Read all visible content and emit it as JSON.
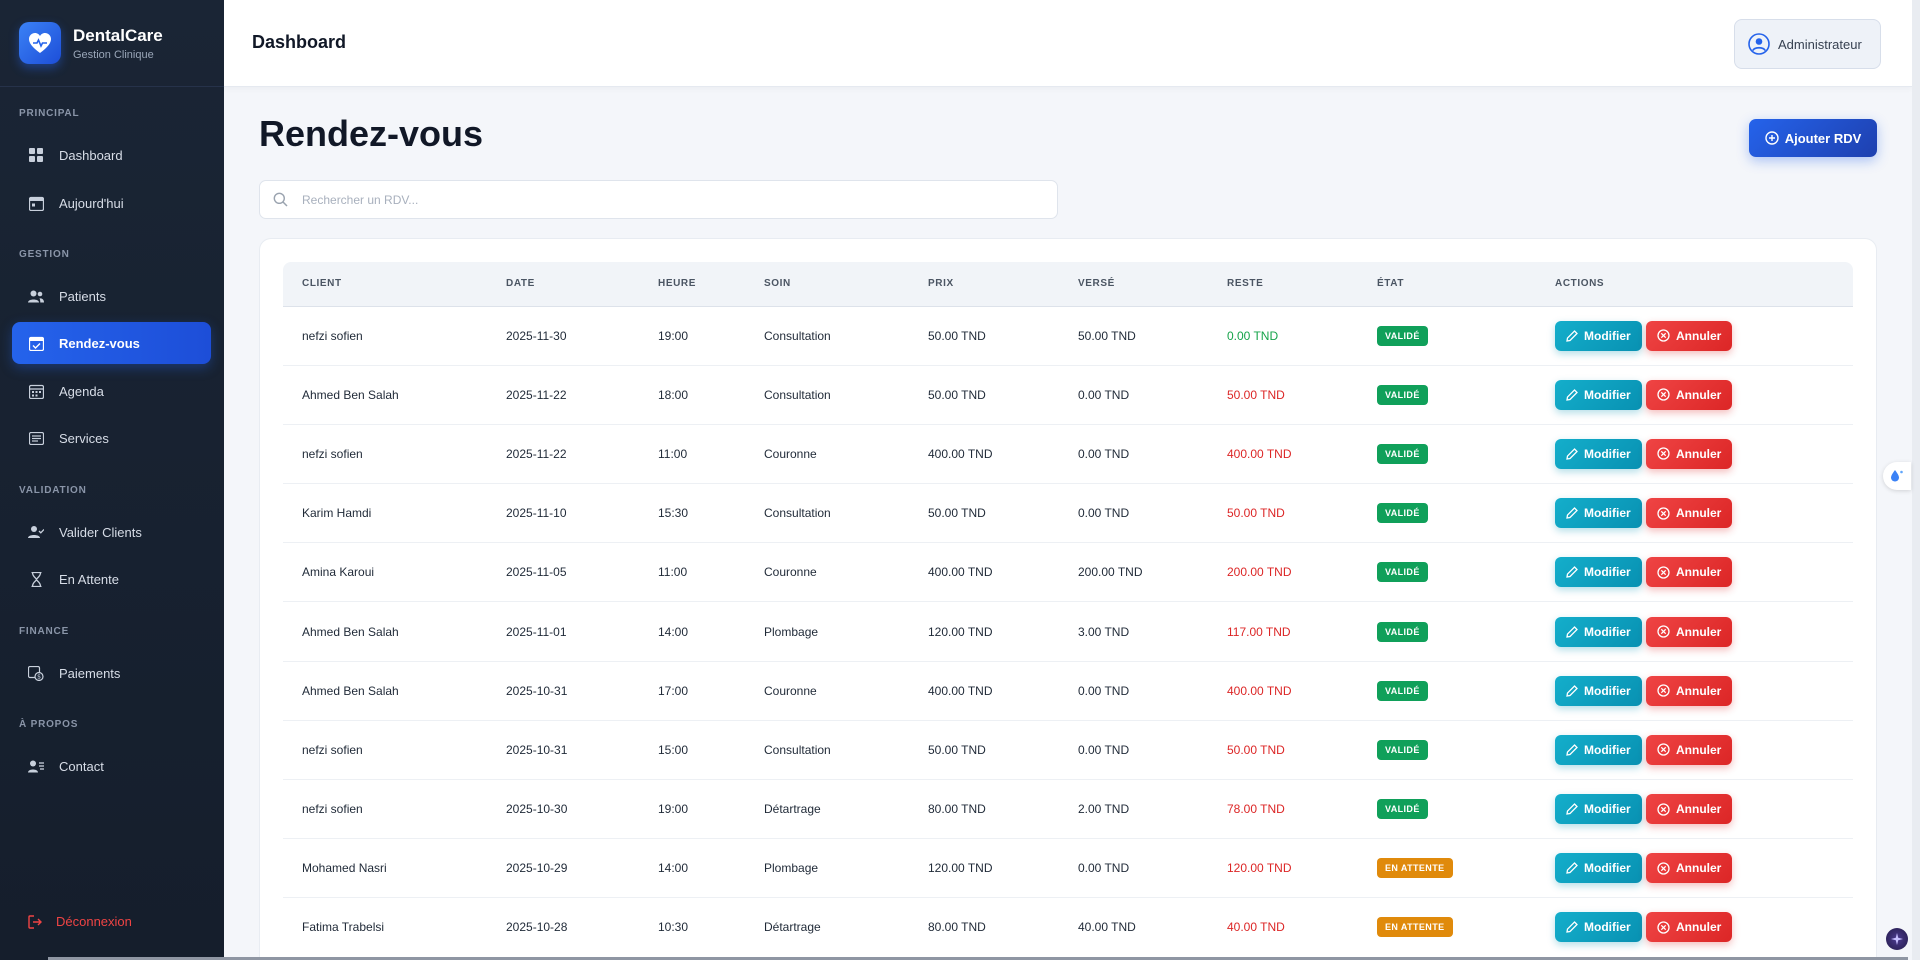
{
  "brand": {
    "name": "DentalCare",
    "subtitle": "Gestion Clinique"
  },
  "sidebar": {
    "sections": [
      {
        "label": "PRINCIPAL"
      },
      {
        "label": "GESTION"
      },
      {
        "label": "VALIDATION"
      },
      {
        "label": "FINANCE"
      },
      {
        "label": "À PROPOS"
      }
    ],
    "items": [
      {
        "label": "Dashboard",
        "icon": "grid-icon"
      },
      {
        "label": "Aujourd'hui",
        "icon": "calendar-day-icon"
      },
      {
        "label": "Patients",
        "icon": "users-icon"
      },
      {
        "label": "Rendez-vous",
        "icon": "calendar-check-icon",
        "active": true
      },
      {
        "label": "Agenda",
        "icon": "calendar-icon"
      },
      {
        "label": "Services",
        "icon": "list-icon"
      },
      {
        "label": "Valider Clients",
        "icon": "user-check-icon"
      },
      {
        "label": "En Attente",
        "icon": "hourglass-icon"
      },
      {
        "label": "Paiements",
        "icon": "payment-icon"
      },
      {
        "label": "Contact",
        "icon": "contact-icon"
      }
    ],
    "logout": "Déconnexion"
  },
  "header": {
    "title": "Dashboard",
    "user": "Administrateur"
  },
  "main": {
    "title": "Rendez-vous",
    "add_button": "Ajouter RDV",
    "search_placeholder": "Rechercher un RDV..."
  },
  "table": {
    "columns": [
      "CLIENT",
      "DATE",
      "HEURE",
      "SOIN",
      "PRIX",
      "VERSÉ",
      "RESTE",
      "ÉTAT",
      "ACTIONS"
    ],
    "edit_label": "Modifier",
    "cancel_label": "Annuler",
    "rows": [
      {
        "client": "nefzi sofien",
        "date": "2025-11-30",
        "heure": "19:00",
        "soin": "Consultation",
        "prix": "50.00 TND",
        "verse": "50.00 TND",
        "reste": "0.00 TND",
        "reste_status": "paid",
        "etat": "VALIDÉ",
        "etat_status": "valide"
      },
      {
        "client": "Ahmed Ben Salah",
        "date": "2025-11-22",
        "heure": "18:00",
        "soin": "Consultation",
        "prix": "50.00 TND",
        "verse": "0.00 TND",
        "reste": "50.00 TND",
        "reste_status": "due",
        "etat": "VALIDÉ",
        "etat_status": "valide"
      },
      {
        "client": "nefzi sofien",
        "date": "2025-11-22",
        "heure": "11:00",
        "soin": "Couronne",
        "prix": "400.00 TND",
        "verse": "0.00 TND",
        "reste": "400.00 TND",
        "reste_status": "due",
        "etat": "VALIDÉ",
        "etat_status": "valide"
      },
      {
        "client": "Karim Hamdi",
        "date": "2025-11-10",
        "heure": "15:30",
        "soin": "Consultation",
        "prix": "50.00 TND",
        "verse": "0.00 TND",
        "reste": "50.00 TND",
        "reste_status": "due",
        "etat": "VALIDÉ",
        "etat_status": "valide"
      },
      {
        "client": "Amina Karoui",
        "date": "2025-11-05",
        "heure": "11:00",
        "soin": "Couronne",
        "prix": "400.00 TND",
        "verse": "200.00 TND",
        "reste": "200.00 TND",
        "reste_status": "due",
        "etat": "VALIDÉ",
        "etat_status": "valide"
      },
      {
        "client": "Ahmed Ben Salah",
        "date": "2025-11-01",
        "heure": "14:00",
        "soin": "Plombage",
        "prix": "120.00 TND",
        "verse": "3.00 TND",
        "reste": "117.00 TND",
        "reste_status": "due",
        "etat": "VALIDÉ",
        "etat_status": "valide"
      },
      {
        "client": "Ahmed Ben Salah",
        "date": "2025-10-31",
        "heure": "17:00",
        "soin": "Couronne",
        "prix": "400.00 TND",
        "verse": "0.00 TND",
        "reste": "400.00 TND",
        "reste_status": "due",
        "etat": "VALIDÉ",
        "etat_status": "valide"
      },
      {
        "client": "nefzi sofien",
        "date": "2025-10-31",
        "heure": "15:00",
        "soin": "Consultation",
        "prix": "50.00 TND",
        "verse": "0.00 TND",
        "reste": "50.00 TND",
        "reste_status": "due",
        "etat": "VALIDÉ",
        "etat_status": "valide"
      },
      {
        "client": "nefzi sofien",
        "date": "2025-10-30",
        "heure": "19:00",
        "soin": "Détartrage",
        "prix": "80.00 TND",
        "verse": "2.00 TND",
        "reste": "78.00 TND",
        "reste_status": "due",
        "etat": "VALIDÉ",
        "etat_status": "valide"
      },
      {
        "client": "Mohamed Nasri",
        "date": "2025-10-29",
        "heure": "14:00",
        "soin": "Plombage",
        "prix": "120.00 TND",
        "verse": "0.00 TND",
        "reste": "120.00 TND",
        "reste_status": "due",
        "etat": "EN ATTENTE",
        "etat_status": "attente"
      },
      {
        "client": "Fatima Trabelsi",
        "date": "2025-10-28",
        "heure": "10:30",
        "soin": "Détartrage",
        "prix": "80.00 TND",
        "verse": "40.00 TND",
        "reste": "40.00 TND",
        "reste_status": "due",
        "etat": "EN ATTENTE",
        "etat_status": "attente"
      }
    ]
  },
  "colors": {
    "sidebar_bg": "#1a2535",
    "accent": "#2563eb",
    "edit": "#0891b2",
    "cancel": "#dc2626",
    "valide": "#10a05a",
    "attente": "#e08a0b",
    "paid": "#16a34a",
    "due": "#dc2626"
  }
}
